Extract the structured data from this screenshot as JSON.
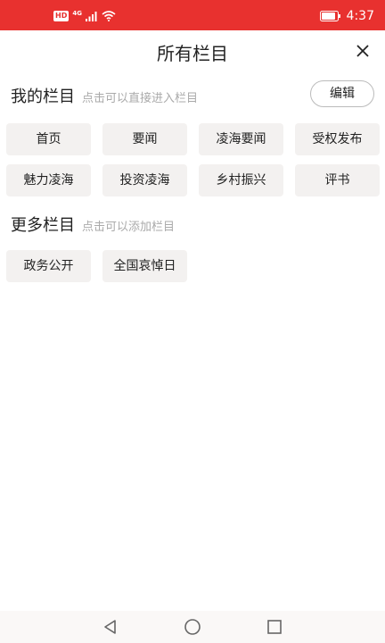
{
  "status_bar": {
    "hd_label": "HD",
    "network_label": "4G",
    "time": "4:37"
  },
  "header": {
    "title": "所有栏目"
  },
  "my_channels": {
    "title": "我的栏目",
    "hint": "点击可以直接进入栏目",
    "edit_label": "编辑",
    "items": [
      "首页",
      "要闻",
      "凌海要闻",
      "受权发布",
      "魅力凌海",
      "投资凌海",
      "乡村振兴",
      "评书"
    ]
  },
  "more_channels": {
    "title": "更多栏目",
    "hint": "点击可以添加栏目",
    "items": [
      "政务公开",
      "全国哀悼日"
    ]
  },
  "colors": {
    "accent": "#e8312f",
    "chip_bg": "#f3f1f0",
    "hint_text": "#aaaaaa"
  },
  "icons": {
    "close": "close-icon",
    "back": "back-triangle-icon",
    "home": "home-circle-icon",
    "recents": "recents-square-icon"
  }
}
